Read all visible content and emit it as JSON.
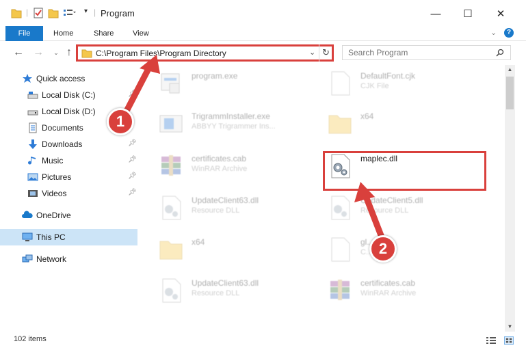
{
  "window": {
    "title": "Program",
    "minimize_glyph": "—",
    "maximize_glyph": "☐",
    "close_glyph": "✕"
  },
  "ribbon": {
    "tabs": [
      {
        "label": "File"
      },
      {
        "label": "Home"
      },
      {
        "label": "Share"
      },
      {
        "label": "View"
      }
    ]
  },
  "address": {
    "path": "C:\\Program Files\\Program Directory",
    "search_placeholder": "Search Program"
  },
  "sidebar": {
    "items": [
      {
        "label": "Quick access",
        "icon": "star-icon"
      },
      {
        "label": "Local Disk (C:)",
        "icon": "drive-icon"
      },
      {
        "label": "Local Disk (D:)",
        "icon": "drive-icon"
      },
      {
        "label": "Documents",
        "icon": "documents-icon"
      },
      {
        "label": "Downloads",
        "icon": "download-arrow-icon"
      },
      {
        "label": "Music",
        "icon": "music-note-icon"
      },
      {
        "label": "Pictures",
        "icon": "pictures-icon"
      },
      {
        "label": "Videos",
        "icon": "film-icon"
      },
      {
        "label": "OneDrive",
        "icon": "cloud-icon"
      },
      {
        "label": "This PC",
        "icon": "monitor-icon"
      },
      {
        "label": "Network",
        "icon": "network-icon"
      }
    ]
  },
  "files": [
    {
      "name": "program.exe",
      "type": "",
      "icon": "exe-icon"
    },
    {
      "name": "DefaultFont.cjk",
      "type": "CJK File",
      "icon": "blank-file-icon"
    },
    {
      "name": "TrigrammInstaller.exe",
      "type": "ABBYY Trigrammer Ins...",
      "icon": "installer-icon"
    },
    {
      "name": "x64",
      "type": "",
      "icon": "folder-icon"
    },
    {
      "name": "certificates.cab",
      "type": "WinRAR Archive",
      "icon": "winrar-icon"
    },
    {
      "name": "maplec.dll",
      "type": "",
      "icon": "dll-gear-icon"
    },
    {
      "name": "UpdateClient63.dll",
      "type": "Resource DLL",
      "icon": "dll-gear-icon"
    },
    {
      "name": "UpdateClient5.dll",
      "type": "Resource DLL",
      "icon": "dll-gear-icon"
    },
    {
      "name": "x64",
      "type": "",
      "icon": "folder-icon"
    },
    {
      "name": "gl...",
      "type": "C...",
      "icon": "blank-file-icon"
    },
    {
      "name": "UpdateClient63.dll",
      "type": "Resource DLL",
      "icon": "dll-gear-icon"
    },
    {
      "name": "certificates.cab",
      "type": "WinRAR Archive",
      "icon": "winrar-icon"
    }
  ],
  "status": {
    "item_count": "102 items"
  },
  "annotations": {
    "callout_1": "1",
    "callout_2": "2",
    "color": "#d9403c"
  },
  "colors": {
    "accent": "#1979ca",
    "selected_bg": "#cce4f7",
    "highlight_red": "#d9403c"
  }
}
